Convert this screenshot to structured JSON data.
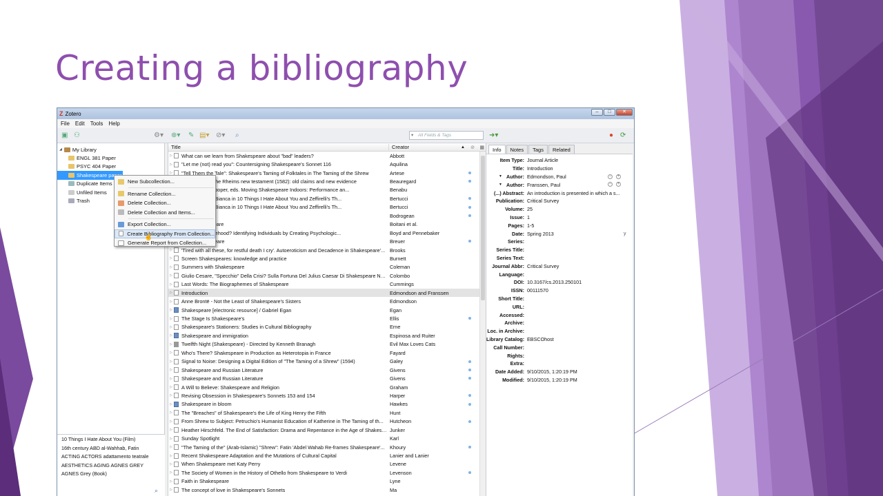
{
  "slide": {
    "title": "Creating a bibliography"
  },
  "window": {
    "app_title": "Zotero",
    "menu": [
      "File",
      "Edit",
      "Tools",
      "Help"
    ],
    "search_placeholder": "All Fields & Tags"
  },
  "library": {
    "items": [
      {
        "label": "My Library",
        "icon": "library-icon"
      },
      {
        "label": "ENGL 381 Paper",
        "icon": "folder-icon"
      },
      {
        "label": "PSYC 404 Paper",
        "icon": "folder-icon"
      },
      {
        "label": "Shakespeare paper",
        "icon": "folder-icon",
        "selected": true
      },
      {
        "label": "Duplicate Items",
        "icon": "duplicate-icon"
      },
      {
        "label": "Unfiled Items",
        "icon": "unfiled-icon"
      },
      {
        "label": "Trash",
        "icon": "trash-icon"
      }
    ]
  },
  "tags": {
    "rows": [
      "10 Things I Hate About You (Film)",
      "16th century    ABD al-Wahhab, Fatin",
      "ACTING    ACTORS    adattamento teatrale",
      "AESTHETICS    AGING    AGNES GREY",
      "AGNES Grey (Book)"
    ]
  },
  "context_menu": {
    "items": [
      {
        "label": "New Subcollection...",
        "icon": "new-subcollection-icon"
      },
      {
        "label": "Rename Collection...",
        "icon": "rename-icon"
      },
      {
        "label": "Delete Collection...",
        "icon": "delete-icon"
      },
      {
        "label": "Delete Collection and Items...",
        "icon": "delete-items-icon"
      },
      {
        "label": "Export Collection...",
        "icon": "export-icon"
      },
      {
        "label": "Create Bibliography From Collection...",
        "icon": "bibliography-icon",
        "highlighted": true
      },
      {
        "label": "Generate Report from Collection...",
        "icon": "report-icon"
      }
    ]
  },
  "items_table": {
    "columns": {
      "title": "Title",
      "creator": "Creator"
    },
    "rows": [
      {
        "title": "What can we learn from Shakespeare about \"bad\" leaders?",
        "creator": "Abbott",
        "dot": false
      },
      {
        "title": "\"Let me (not) read you\": Countersigning Shakespeare's Sonnet 116",
        "creator": "Aquilina",
        "dot": false
      },
      {
        "title": "\"Tell Them the Tale\": Shakespeare's Taming of Folktales in The Taming of the Shrew",
        "creator": "Artese",
        "dot": true
      },
      {
        "title": "Shakespeare, the Rheims new testament (1582): old claims and new evidence",
        "creator": "Beauregard",
        "dot": true
      },
      {
        "title": "Sarah Karim-Cooper, eds. Moving Shakespeare Indoors: Performance an...",
        "creator": "Benabu",
        "dot": false
      },
      {
        "title": "by Recovering Bianca in 10 Things I Hate About You and Zeffirelli's Th...",
        "creator": "Bertucci",
        "dot": true
      },
      {
        "title": "by Recovering Bianca in 10 Things I Hate About You and Zeffirelli's Th...",
        "creator": "Bertucci",
        "dot": true
      },
      {
        "title": "Games",
        "creator": "Bodrogean",
        "dot": true
      },
      {
        "title": "ng to Shakespeare",
        "creator": "Boitani et al.",
        "dot": false
      },
      {
        "title": "ite Double Falsehood? Identifying Individuals by Creating Psychologic...",
        "creator": "Boyd and Pennebaker",
        "dot": false
      },
      {
        "title": "ion in Shakespeare",
        "creator": "Breuer",
        "dot": true
      },
      {
        "title": "'Tired with all these, for restful death I cry'. Autoeroticism and Decadence in Shakespeare'...",
        "creator": "Brooks",
        "dot": false
      },
      {
        "title": "Screen Shakespeares: knowledge and practice",
        "creator": "Burnett",
        "dot": false
      },
      {
        "title": "Summers with Shakespeare",
        "creator": "Coleman",
        "dot": false
      },
      {
        "title": "Giulio Cesare, \"Specchio\" Della Crisi? Sulla Fortuna Del Julius Caesar Di Shakespeare Nel T...",
        "creator": "Colombo",
        "dot": false
      },
      {
        "title": "Last Words: The Biographemes of Shakespeare",
        "creator": "Cummings",
        "dot": false
      },
      {
        "title": "Introduction",
        "creator": "Edmondson and Franssen",
        "dot": false,
        "selected": true
      },
      {
        "title": "Anne Brontë - Not the Least of Shakespeare's Sisters",
        "creator": "Edmondson",
        "dot": false
      },
      {
        "title": "Shakespeare [electronic resource] / Gabriel Egan",
        "creator": "Egan",
        "dot": false,
        "type": "book"
      },
      {
        "title": "The Stage Is Shakespeare's",
        "creator": "Ellis",
        "dot": true
      },
      {
        "title": "Shakespeare's Stationers: Studies in Cultural Bibliography",
        "creator": "Erne",
        "dot": false
      },
      {
        "title": "Shakespeare and immigration",
        "creator": "Espinosa and Ruiter",
        "dot": false,
        "type": "book"
      },
      {
        "title": "Twelfth Night (Shakespeare) - Directed by Kenneth Branagh",
        "creator": "Evil Max Loves Cats",
        "dot": false,
        "type": "film"
      },
      {
        "title": "Who's There? Shakespeare in Production as Heterotopia in France",
        "creator": "Fayard",
        "dot": false
      },
      {
        "title": "Signal to Noise: Designing a Digital Edition of \"The Taming of a Shrew\" (1594)",
        "creator": "Galey",
        "dot": true
      },
      {
        "title": "Shakespeare and Russian Literature",
        "creator": "Givens",
        "dot": true
      },
      {
        "title": "Shakespeare and Russian Literature",
        "creator": "Givens",
        "dot": true
      },
      {
        "title": "A Will to Believe: Shakespeare and Religion",
        "creator": "Graham",
        "dot": false
      },
      {
        "title": "Revising Obsession in Shakespeare's Sonnets 153 and 154",
        "creator": "Harper",
        "dot": true
      },
      {
        "title": "Shakespeare in bloom",
        "creator": "Hawkes",
        "dot": true,
        "type": "book"
      },
      {
        "title": "The \"Breaches\" of Shakespeare's the Life of King Henry the Fifth",
        "creator": "Hunt",
        "dot": false
      },
      {
        "title": "From Shrew to Subject: Petruchio's Humanist Education of Katherine in The Taming of th...",
        "creator": "Hutcheon",
        "dot": true
      },
      {
        "title": "Heather Hirschfeld. The End of Satisfaction: Drama and Repentance in the Age of Shakesp...",
        "creator": "Junker",
        "dot": false
      },
      {
        "title": "Sunday Spotlight",
        "creator": "Karl",
        "dot": false
      },
      {
        "title": "\"The Taming of the\" (Arab-Islamic) \"Shrew\": Fatin 'Abdel Wahab Re-frames Shakespeare'...",
        "creator": "Khoury",
        "dot": true
      },
      {
        "title": "Recent Shakespeare Adaptation and the Mutations of Cultural Capital",
        "creator": "Lanier and Lanier",
        "dot": false
      },
      {
        "title": "When Shakespeare met Katy Perry",
        "creator": "Levene",
        "dot": false
      },
      {
        "title": "The Society of Women in the History of Othello from Shakespeare to Verdi",
        "creator": "Levenson",
        "dot": true
      },
      {
        "title": "Faith in Shakespeare",
        "creator": "Lyne",
        "dot": false
      },
      {
        "title": "The concept of love in Shakespeare's Sonnets",
        "creator": "Ma",
        "dot": false
      }
    ]
  },
  "item_pane": {
    "tabs": [
      "Info",
      "Notes",
      "Tags",
      "Related"
    ],
    "fields": [
      {
        "label": "Item Type:",
        "value": "Journal Article"
      },
      {
        "label": "Title:",
        "value": "Introduction"
      },
      {
        "label": "Author:",
        "value": "Edmondson, Paul",
        "author": true
      },
      {
        "label": "Author:",
        "value": "Franssen, Paul",
        "author": true
      },
      {
        "label": "(...) Abstract:",
        "value": "An introduction is presented in which a s..."
      },
      {
        "label": "Publication:",
        "value": "Critical Survey"
      },
      {
        "label": "Volume:",
        "value": "25"
      },
      {
        "label": "Issue:",
        "value": "1"
      },
      {
        "label": "Pages:",
        "value": "1-5"
      },
      {
        "label": "Date:",
        "value": "Spring 2013"
      },
      {
        "label": "Series:",
        "value": ""
      },
      {
        "label": "Series Title:",
        "value": ""
      },
      {
        "label": "Series Text:",
        "value": ""
      },
      {
        "label": "Journal Abbr:",
        "value": "Critical Survey"
      },
      {
        "label": "Language:",
        "value": ""
      },
      {
        "label": "DOI:",
        "value": "10.3167/cs.2013.250101"
      },
      {
        "label": "ISSN:",
        "value": "00111570"
      },
      {
        "label": "Short Title:",
        "value": ""
      },
      {
        "label": "URL:",
        "value": ""
      },
      {
        "label": "Accessed:",
        "value": ""
      },
      {
        "label": "Archive:",
        "value": ""
      },
      {
        "label": "Loc. in Archive:",
        "value": ""
      },
      {
        "label": "Library Catalog:",
        "value": "EBSCOhost"
      },
      {
        "label": "Call Number:",
        "value": ""
      },
      {
        "label": "Rights:",
        "value": ""
      },
      {
        "label": "Extra:",
        "value": ""
      },
      {
        "label": "Date Added:",
        "value": "9/10/2015, 1:20:19 PM"
      },
      {
        "label": "Modified:",
        "value": "9/10/2015, 1:20:19 PM"
      }
    ],
    "date_marker": "y"
  },
  "colors": {
    "title_purple": "#8e4fae",
    "selection_blue": "#3399ff"
  }
}
